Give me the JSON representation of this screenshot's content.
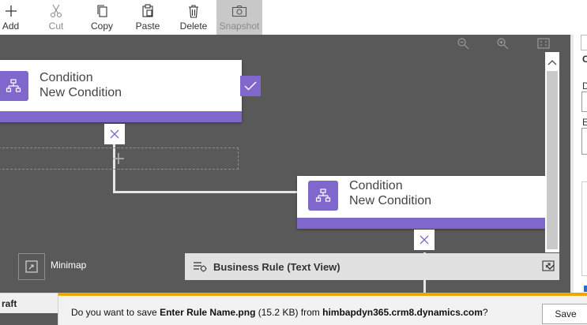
{
  "toolbar": {
    "add_label": "Add",
    "cut_label": "Cut",
    "copy_label": "Copy",
    "paste_label": "Paste",
    "delete_label": "Delete",
    "snapshot_label": "Snapshot"
  },
  "canvas": {
    "nodes": [
      {
        "type": "Condition",
        "name": "New Condition"
      },
      {
        "type": "Condition",
        "name": "New Condition"
      }
    ],
    "minimap_label": "Minimap",
    "business_rule_label": "Business Rule (Text View)"
  },
  "right_panel": {
    "letters": [
      "C",
      "D",
      "E"
    ]
  },
  "draft_tab": "raft",
  "download_bar": {
    "prefix": "Do you want to save ",
    "file_name": "Enter Rule Name.png",
    "size": " (15.2 KB) from ",
    "domain": "himbapdyn365.crm8.dynamics.com",
    "suffix": "?",
    "save_label": "Save"
  },
  "colors": {
    "accent": "#8067cc",
    "canvas_bg": "#595959",
    "download_bar_accent": "#f0a500"
  }
}
